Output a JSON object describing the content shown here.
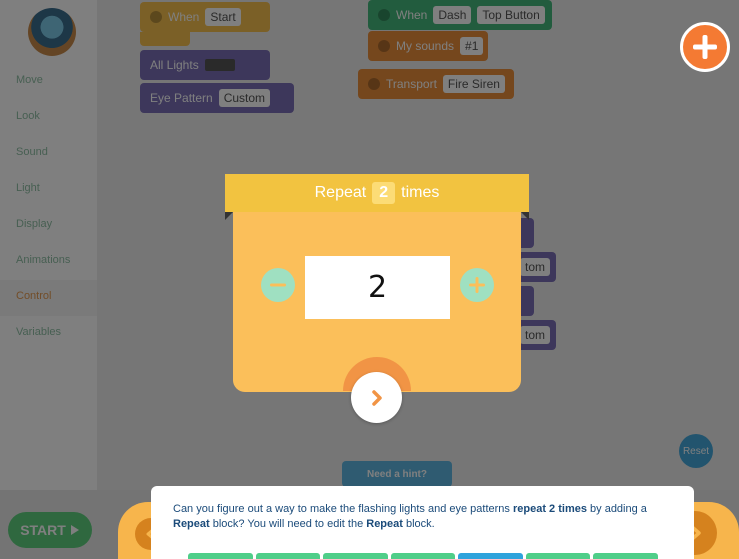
{
  "sidebar": {
    "categories": [
      {
        "label": "Move"
      },
      {
        "label": "Look"
      },
      {
        "label": "Sound"
      },
      {
        "label": "Light"
      },
      {
        "label": "Display"
      },
      {
        "label": "Animations"
      },
      {
        "label": "Control"
      },
      {
        "label": "Variables"
      }
    ],
    "active_category": "Control"
  },
  "canvas": {
    "blocks": {
      "when_start": {
        "label": "When",
        "value": "Start"
      },
      "all_lights": {
        "label": "All Lights"
      },
      "eye_pattern": {
        "label": "Eye Pattern",
        "value": "Custom"
      },
      "when_dash": {
        "label": "When",
        "value1": "Dash",
        "value2": "Top Button"
      },
      "my_sounds": {
        "label": "My sounds",
        "value": "#1"
      },
      "transport": {
        "label": "Transport",
        "value": "Fire Siren"
      },
      "partial_1": {
        "value": "tom"
      },
      "partial_2": {
        "value": "tom"
      }
    },
    "hint_label": "Need a hint?",
    "reset_label": "Reset"
  },
  "start_button": {
    "label": "START"
  },
  "modal": {
    "header_prefix": "Repeat",
    "header_value": "2",
    "header_suffix": "times",
    "count": "2"
  },
  "instruction": {
    "t1": "Can you figure out a way to make the flashing lights and eye patterns ",
    "b1": "repeat 2 times",
    "t2": " by adding a ",
    "b2": "Repeat",
    "t3": " block? You will need to edit the ",
    "b3": "Repeat",
    "t4": " block."
  },
  "progress": {
    "total_steps": 7,
    "current_step": 5
  },
  "colors": {
    "modal_header": "#f2c340",
    "modal_body": "#fbbf5a",
    "stepper_button": "#9fe0c1",
    "add_button": "#f47a33",
    "progress_done": "#4fce89",
    "progress_current": "#2ea3dc"
  }
}
